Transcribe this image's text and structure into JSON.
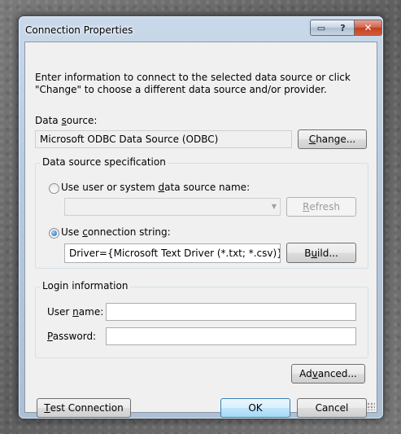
{
  "window": {
    "title": "Connection Properties"
  },
  "intro": "Enter information to connect to the selected data source or click \"Change\" to choose a different data source and/or provider.",
  "data_source": {
    "label_prefix": "Data ",
    "label_access": "s",
    "label_suffix": "ource:",
    "value": "Microsoft ODBC Data Source (ODBC)",
    "change_prefix": "",
    "change_access": "C",
    "change_suffix": "hange..."
  },
  "spec": {
    "group_label": "Data source specification",
    "dsn_prefix": "Use user or system ",
    "dsn_access": "d",
    "dsn_suffix": "ata source name:",
    "dsn_value": "",
    "refresh_prefix": "",
    "refresh_access": "R",
    "refresh_suffix": "efresh",
    "connstr_prefix": "Use ",
    "connstr_access": "c",
    "connstr_suffix": "onnection string:",
    "connstr_value": "Driver={Microsoft Text Driver (*.txt; *.csv)};dbq=.;e",
    "build_prefix": "B",
    "build_access": "u",
    "build_suffix": "ild...",
    "selected": "connection_string"
  },
  "login": {
    "group_label": "Login information",
    "user_prefix": "User ",
    "user_access": "n",
    "user_suffix": "ame:",
    "user_value": "",
    "pass_prefix": "",
    "pass_access": "P",
    "pass_suffix": "assword:",
    "pass_value": ""
  },
  "buttons": {
    "advanced_prefix": "Ad",
    "advanced_access": "v",
    "advanced_suffix": "anced...",
    "test_prefix": "",
    "test_access": "T",
    "test_suffix": "est Connection",
    "ok": "OK",
    "cancel": "Cancel"
  },
  "icons": [
    "restore-icon",
    "help-icon",
    "close-icon",
    "dropdown-arrow-icon",
    "resize-grip-icon"
  ]
}
